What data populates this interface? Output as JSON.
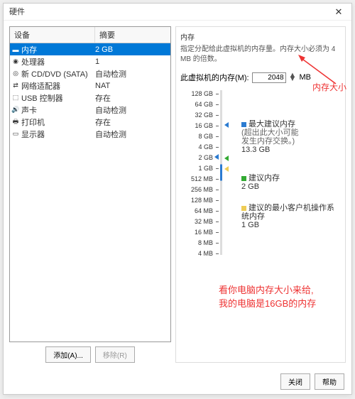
{
  "title": "硬件",
  "columns": {
    "device": "设备",
    "summary": "摘要"
  },
  "devices": [
    {
      "icon": "▬",
      "name": "内存",
      "summary": "2 GB"
    },
    {
      "icon": "◉",
      "name": "处理器",
      "summary": "1"
    },
    {
      "icon": "◎",
      "name": "新 CD/DVD (SATA)",
      "summary": "自动检测"
    },
    {
      "icon": "⇄",
      "name": "网络适配器",
      "summary": "NAT"
    },
    {
      "icon": "⬚",
      "name": "USB 控制器",
      "summary": "存在"
    },
    {
      "icon": "🔊",
      "name": "声卡",
      "summary": "自动检测"
    },
    {
      "icon": "🖶",
      "name": "打印机",
      "summary": "存在"
    },
    {
      "icon": "▭",
      "name": "显示器",
      "summary": "自动检测"
    }
  ],
  "buttons": {
    "add": "添加(A)...",
    "remove": "移除(R)",
    "close": "关闭",
    "help": "帮助"
  },
  "mem": {
    "section": "内存",
    "desc": "指定分配给此虚拟机的内存量。内存大小必须为 4 MB 的倍数。",
    "label": "此虚拟机的内存(M):",
    "value": "2048",
    "unit": "MB"
  },
  "ticks": [
    "128 GB",
    "64 GB",
    "32 GB",
    "16 GB",
    "8 GB",
    "4 GB",
    "2 GB",
    "1 GB",
    "512 MB",
    "256 MB",
    "128 MB",
    "64 MB",
    "32 MB",
    "16 MB",
    "8 MB",
    "4 MB"
  ],
  "legend": {
    "max": "最大建议内存",
    "maxnote": "(超出此大小可能\n发生内存交换。)",
    "maxval": "13.3 GB",
    "rec": "建议内存",
    "recval": "2 GB",
    "min": "建议的最小客户机操作系统内存",
    "minval": "1 GB"
  },
  "anno": {
    "size": "内存大小",
    "note": "看你电脑内存大小来给,\n我的电脑是16GB的内存"
  },
  "chart_data": {
    "type": "scale",
    "unit": "MB",
    "current": 2048,
    "max_recommended_gb": 13.3,
    "recommended_gb": 2,
    "min_recommended_gb": 1,
    "range_labels": [
      "128 GB",
      "64 GB",
      "32 GB",
      "16 GB",
      "8 GB",
      "4 GB",
      "2 GB",
      "1 GB",
      "512 MB",
      "256 MB",
      "128 MB",
      "64 MB",
      "32 MB",
      "16 MB",
      "8 MB",
      "4 MB"
    ]
  }
}
